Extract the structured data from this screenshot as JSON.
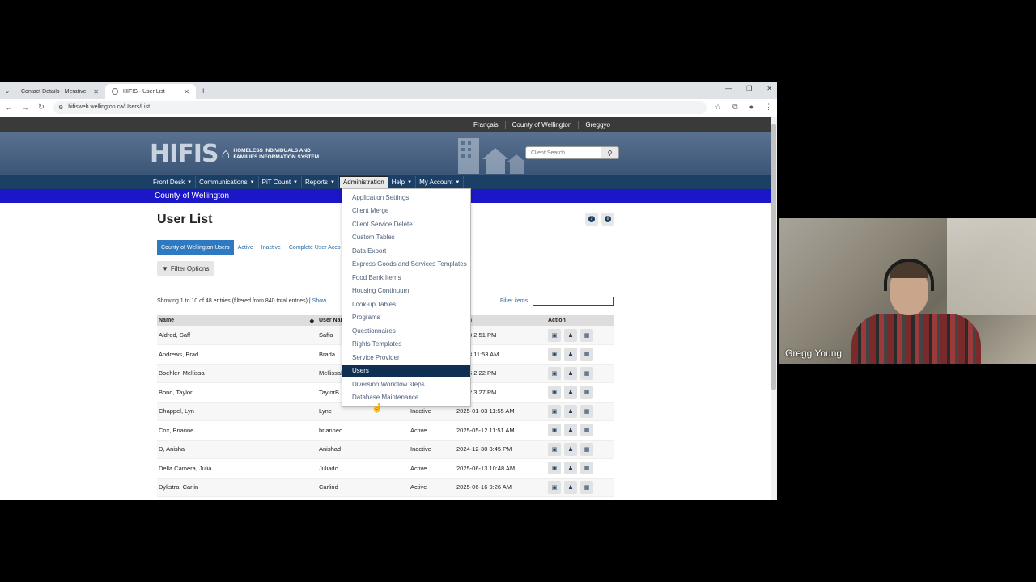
{
  "browser": {
    "tabs": [
      {
        "title": "Contact Details - Merative Soci"
      },
      {
        "title": "HIFIS - User List"
      }
    ],
    "url": "hifisweb.wellington.ca/Users/List"
  },
  "topstrip": {
    "links": [
      "Français",
      "County of Wellington",
      "Greggyo"
    ]
  },
  "banner": {
    "logo_big": "HIFIS",
    "logo_sub_line1": "HOMELESS INDIVIDUALS AND",
    "logo_sub_line2": "FAMILIES INFORMATION SYSTEM",
    "search_placeholder": "Client Search"
  },
  "mainnav": {
    "items": [
      "Front Desk",
      "Communications",
      "PiT Count",
      "Reports",
      "Administration",
      "Help",
      "My Account"
    ]
  },
  "county_bar": "County of Wellington",
  "page": {
    "title": "User List",
    "subtabs": [
      "County of Wellington Users",
      "Active",
      "Inactive",
      "Complete User Acco"
    ],
    "filter_options": "Filter Options",
    "showing": "Showing 1 to 10 of 48 entries (filtered from 840 total entries) |",
    "show_link": "Show",
    "filter_items": "Filter items"
  },
  "table": {
    "headers": [
      "Name",
      "User Nar",
      "",
      "Login",
      "Action"
    ],
    "rows": [
      {
        "name": "Aldred, Saff",
        "user": "Saffa",
        "status": "",
        "login": "12-23 2:51 PM"
      },
      {
        "name": "Andrews, Brad",
        "user": "Brada",
        "status": "",
        "login": "01-03 11:53 AM"
      },
      {
        "name": "Boehler, Mellissa",
        "user": "Mellissal",
        "status": "",
        "login": "06-06 2:22 PM"
      },
      {
        "name": "Bond, Taylor",
        "user": "TaylorB",
        "status": "",
        "login": "05-12 3:27 PM"
      },
      {
        "name": "Chappel, Lyn",
        "user": "Lync",
        "status": "Inactive",
        "login": "2025-01-03 11:55 AM"
      },
      {
        "name": "Cox, Brianne",
        "user": "briannec",
        "status": "Active",
        "login": "2025-05-12 11:51 AM"
      },
      {
        "name": "D, Anisha",
        "user": "Anishad",
        "status": "Inactive",
        "login": "2024-12-30 3:45 PM"
      },
      {
        "name": "Della Camera, Julia",
        "user": "Juliadc",
        "status": "Active",
        "login": "2025-06-13 10:48 AM"
      },
      {
        "name": "Dykstra, Carlin",
        "user": "Carlind",
        "status": "Active",
        "login": "2025-06-16 9:26 AM"
      }
    ]
  },
  "admin_menu": {
    "items": [
      "Application Settings",
      "Client Merge",
      "Client Service Delete",
      "Custom Tables",
      "Data Export",
      "Express Goods and Services Templates",
      "Food Bank Items",
      "Housing Continuum",
      "Look-up Tables",
      "Programs",
      "Questionnaires",
      "Rights Templates",
      "Service Provider",
      "Users",
      "Diversion Workflow steps",
      "Database Maintenance"
    ],
    "selected": "Users"
  },
  "webcam": {
    "name": "Gregg Young"
  },
  "colors": {
    "nav_bg": "#1c3f66",
    "county_bar": "#1b17c8",
    "selected_menu": "#0f2f52",
    "subtab_active": "#2e79c0"
  }
}
